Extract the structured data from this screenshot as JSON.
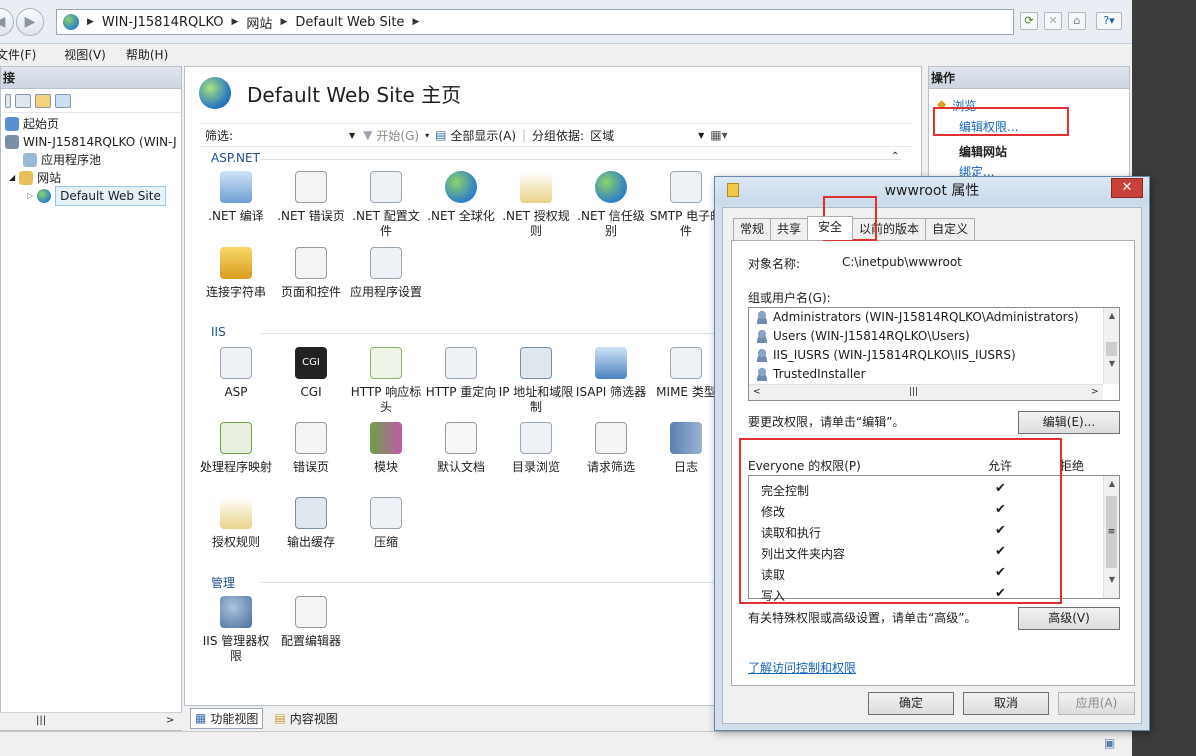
{
  "address": {
    "crumbs": [
      "WIN-J15814RQLKO",
      "网站",
      "Default Web Site"
    ]
  },
  "menu": [
    "文件(F)",
    "视图(V)",
    "帮助(H)"
  ],
  "left": {
    "title": "接",
    "tree": [
      "起始页",
      "WIN-J15814RQLKO (WIN-J",
      "应用程序池",
      "网站",
      "Default Web Site"
    ]
  },
  "center": {
    "title": "Default Web Site 主页",
    "filter_label": "筛选:",
    "start_label": "开始(G)",
    "showall_label": "全部显示(A)",
    "groupby_label": "分组依据:",
    "groupby_value": "区域",
    "groups": {
      "aspnet": "ASP.NET",
      "iis": "IIS",
      "mgmt": "管理"
    },
    "features": {
      "net_compile": ".NET 编译",
      "net_error": ".NET 错误页",
      "net_config": ".NET 配置文件",
      "net_global": ".NET 全球化",
      "net_auth": ".NET 授权规则",
      "net_trust": ".NET 信任级别",
      "smtp": "SMTP 电子邮件",
      "connstr": "连接字符串",
      "pages": "页面和控件",
      "appsettings": "应用程序设置",
      "asp": "ASP",
      "cgi": "CGI",
      "http_headers": "HTTP 响应标头",
      "http_redirect": "HTTP 重定向",
      "ip_restrict": "IP 地址和域限制",
      "isapi": "ISAPI 筛选器",
      "mime": "MIME 类型",
      "handlers": "处理程序映射",
      "errorpages": "错误页",
      "modules": "模块",
      "default_doc": "默认文档",
      "dir_browse": "目录浏览",
      "req_filter": "请求筛选",
      "logging": "日志",
      "authz": "授权规则",
      "output_cache": "输出缓存",
      "compress": "压缩",
      "iis_mgr_perm": "IIS 管理器权限",
      "config_editor": "配置编辑器"
    },
    "tabs": [
      "功能视图",
      "内容视图"
    ]
  },
  "actions": {
    "title": "操作",
    "browse": "浏览",
    "edit_perm": "编辑权限...",
    "edit_site": "编辑网站",
    "bindings": "绑定..."
  },
  "dialog": {
    "title": "wwwroot 属性",
    "tabs": [
      "常规",
      "共享",
      "安全",
      "以前的版本",
      "自定义"
    ],
    "object_label": "对象名称:",
    "object_value": "C:\\inetpub\\wwwroot",
    "groups_label": "组或用户名(G):",
    "users": [
      "Administrators (WIN-J15814RQLKO\\Administrators)",
      "Users (WIN-J15814RQLKO\\Users)",
      "IIS_IUSRS (WIN-J15814RQLKO\\IIS_IUSRS)",
      "TrustedInstaller"
    ],
    "change_hint": "要更改权限，请单击“编辑”。",
    "edit_btn": "编辑(E)...",
    "perm_header": "Everyone 的权限(P)",
    "allow_col": "允许",
    "deny_col": "拒绝",
    "permissions": [
      "完全控制",
      "修改",
      "读取和执行",
      "列出文件夹内容",
      "读取",
      "写入"
    ],
    "checkmark": "✔",
    "advanced_hint": "有关特殊权限或高级设置，请单击“高级”。",
    "advanced_btn": "高级(V)",
    "learn_link": "了解访问控制和权限",
    "ok": "确定",
    "cancel": "取消",
    "apply": "应用(A)"
  },
  "colors": {
    "highlight": "#e03030",
    "link": "#1565c0"
  }
}
